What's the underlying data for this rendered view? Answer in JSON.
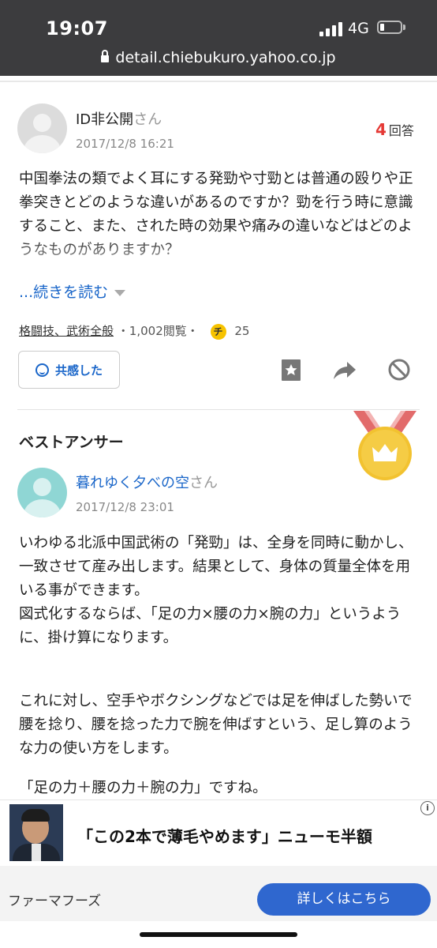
{
  "status_bar": {
    "time": "19:07",
    "network": "4G"
  },
  "browser": {
    "url": "detail.chiebukuro.yahoo.co.jp"
  },
  "question": {
    "user_name": "ID非公開",
    "user_suffix": "さん",
    "date": "2017/12/8 16:21",
    "answer_count": "4",
    "answer_count_label": "回答",
    "text": "中国拳法の類でよく耳にする発勁や寸勁とは普通の殴りや正拳突きとどのような違いがあるのですか？勁を行う時に意識すること、また、された時の効果や痛みの違いなどはどのようなものがありますか？",
    "read_more": "...続きを読む",
    "category": "格闘技、武術全般",
    "views": "・1,002閲覧・",
    "coin_icon_text": "チ",
    "coins": "25",
    "empathy_button": "共感した"
  },
  "best_answer": {
    "section_title": "ベストアンサー",
    "user_name": "暮れゆく夕べの空",
    "user_suffix": "さん",
    "date": "2017/12/8 23:01",
    "paragraph1": "いわゆる北派中国武術の「発勁」は、全身を同時に動かし、一致させて産み出します。結果として、身体の質量全体を用いる事ができます。",
    "paragraph2": "図式化するならば、「足の力×腰の力×腕の力」というように、掛け算になります。",
    "paragraph3": "これに対し、空手やボクシングなどでは足を伸ばした勢いで腰を捻り、腰を捻った力で腕を伸ばすという、足し算のような力の使い方をします。",
    "paragraph4": "「足の力＋腰の力＋腕の力」ですね。"
  },
  "ad": {
    "info_icon": "i",
    "headline": "「この2本で薄毛やめます」ニューモ半額",
    "brand": "ファーマフーズ",
    "cta": "詳しくはこちら"
  },
  "colors": {
    "accent_blue": "#1a66c9",
    "answer_count_red": "#e53935",
    "medal_gold": "#f2c230",
    "ribbon_red": "#e26b6b",
    "cta_blue": "#2f67cf"
  }
}
